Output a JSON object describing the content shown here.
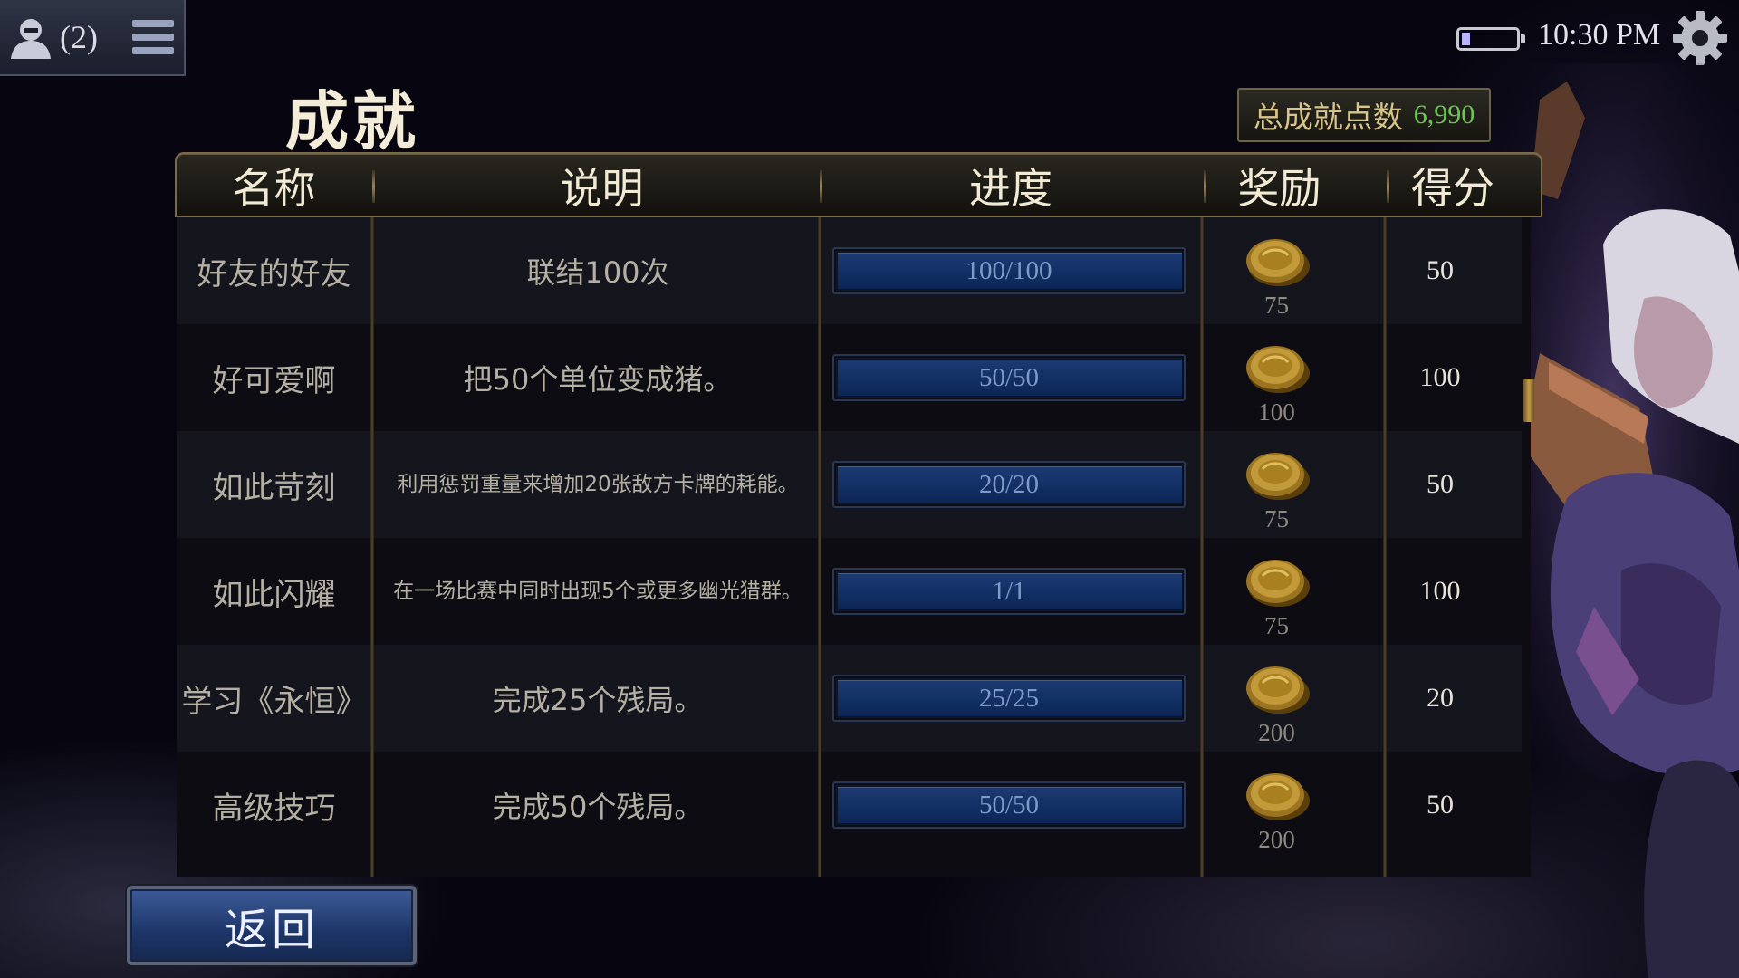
{
  "top_bar": {
    "friends_count": "(2)",
    "time": "10:30 PM",
    "battery_level": 0.15,
    "icons": [
      "friends-icon",
      "menu-icon",
      "battery-icon",
      "gear-icon"
    ]
  },
  "page": {
    "title": "成就",
    "total_label": "总成就点数",
    "total_value": "6,990"
  },
  "table": {
    "headers": {
      "name": "名称",
      "description": "说明",
      "progress": "进度",
      "reward": "奖励",
      "score": "得分"
    },
    "rows": [
      {
        "name": "好友的好友",
        "description": "联结100次",
        "progress": "100/100",
        "progress_fraction": 1,
        "reward": "75",
        "score": "50"
      },
      {
        "name": "好可爱啊",
        "description": "把50个单位变成猪。",
        "progress": "50/50",
        "progress_fraction": 1,
        "reward": "100",
        "score": "100"
      },
      {
        "name": "如此苛刻",
        "description": "利用惩罚重量来增加20张敌方卡牌的耗能。",
        "progress": "20/20",
        "progress_fraction": 1,
        "reward": "75",
        "score": "50"
      },
      {
        "name": "如此闪耀",
        "description": "在一场比赛中同时出现5个或更多幽光猎群。",
        "progress": "1/1",
        "progress_fraction": 1,
        "reward": "75",
        "score": "100"
      },
      {
        "name": "学习《永恒》",
        "description": "完成25个残局。",
        "progress": "25/25",
        "progress_fraction": 1,
        "reward": "200",
        "score": "20"
      },
      {
        "name": "高级技巧",
        "description": "完成50个残局。",
        "progress": "50/50",
        "progress_fraction": 1,
        "reward": "200",
        "score": "50"
      }
    ]
  },
  "buttons": {
    "back_label": "返回"
  },
  "colors": {
    "accent_gold": "#d8c58c",
    "total_value_green": "#6cc653",
    "progress_blue": "#123064",
    "back_button_blue": "#1d3568"
  }
}
